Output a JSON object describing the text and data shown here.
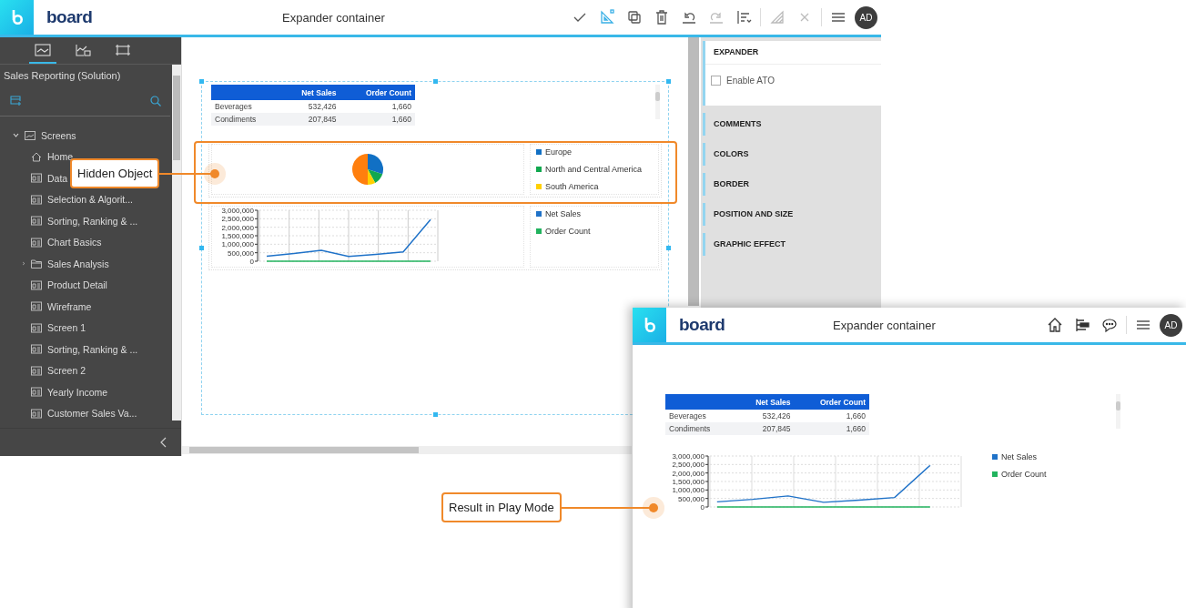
{
  "editor": {
    "brand": "board",
    "title": "Expander container",
    "toolbar": [
      {
        "kind": "check",
        "selected": false,
        "disabled": false
      },
      {
        "kind": "design",
        "selected": true,
        "disabled": false
      },
      {
        "kind": "duplicate",
        "selected": false,
        "disabled": false
      },
      {
        "kind": "delete",
        "selected": false,
        "disabled": false
      },
      {
        "kind": "undo",
        "selected": false,
        "disabled": false
      },
      {
        "kind": "redo",
        "selected": false,
        "disabled": true
      },
      {
        "kind": "align",
        "selected": false,
        "disabled": false
      },
      {
        "kind": "hatch",
        "selected": false,
        "disabled": true
      },
      {
        "kind": "close",
        "selected": false,
        "disabled": true
      },
      {
        "kind": "menu",
        "selected": false,
        "disabled": false
      }
    ],
    "avatar": "AD",
    "sidebar": {
      "tabs": [
        {
          "kind": "screens",
          "selected": true
        },
        {
          "kind": "charts",
          "selected": false
        },
        {
          "kind": "layout",
          "selected": false
        }
      ],
      "project": "Sales Reporting (Solution)",
      "tree": [
        {
          "label": "Screens",
          "kind": "root",
          "expanded": true,
          "children": [
            {
              "label": "Home",
              "kind": "home"
            },
            {
              "label": "Data",
              "kind": "screen"
            },
            {
              "label": "Selection & Algorit...",
              "kind": "screen"
            },
            {
              "label": "Sorting, Ranking & ...",
              "kind": "screen"
            },
            {
              "label": "Chart Basics",
              "kind": "screen"
            },
            {
              "label": "Sales Analysis",
              "kind": "folder",
              "expanded": false
            },
            {
              "label": "Product Detail",
              "kind": "screen"
            },
            {
              "label": "Wireframe",
              "kind": "screen"
            },
            {
              "label": "Screen 1",
              "kind": "screen"
            },
            {
              "label": "Sorting, Ranking & ...",
              "kind": "screen"
            },
            {
              "label": "Screen 2",
              "kind": "screen"
            },
            {
              "label": "Yearly Income",
              "kind": "screen"
            },
            {
              "label": "Customer Sales Va...",
              "kind": "screen"
            }
          ]
        }
      ]
    },
    "canvas": {
      "table": {
        "columns": [
          "",
          "Net Sales",
          "Order Count"
        ],
        "rows": [
          [
            "Beverages",
            "532,426",
            "1,660"
          ],
          [
            "Condiments",
            "207,845",
            "1,660"
          ]
        ]
      },
      "pie_legend": [
        {
          "label": "Europe",
          "color": "#1170c4"
        },
        {
          "label": "North and Central America",
          "color": "#11a84f"
        },
        {
          "label": "South America",
          "color": "#ffd000"
        }
      ],
      "line_chart": {
        "chart_data": {
          "type": "line",
          "grid": true,
          "ylim": [
            0,
            3000000
          ],
          "yticks": [
            {
              "value": 0,
              "label": "0"
            },
            {
              "value": 500000,
              "label": "500,000"
            },
            {
              "value": 1000000,
              "label": "1,000,000"
            },
            {
              "value": 1500000,
              "label": "1,500,000"
            },
            {
              "value": 2000000,
              "label": "2,000,000"
            },
            {
              "value": 2500000,
              "label": "2,500,000"
            },
            {
              "value": 3000000,
              "label": "3,000,000"
            }
          ],
          "series": [
            {
              "name": "Net Sales",
              "color": "#1f72c8",
              "values": [
                300000,
                450000,
                650000,
                280000,
                400000,
                550000,
                2450000
              ]
            },
            {
              "name": "Order Count",
              "color": "#22b35e",
              "values": [
                0,
                0,
                0,
                0,
                0,
                0,
                0
              ]
            }
          ]
        }
      }
    },
    "properties": [
      {
        "label": "EXPANDER",
        "expanded": true,
        "options": [
          {
            "label": "Enable ATO",
            "checked": false
          }
        ]
      },
      {
        "label": "COMMENTS",
        "expanded": false
      },
      {
        "label": "COLORS",
        "expanded": false
      },
      {
        "label": "BORDER",
        "expanded": false
      },
      {
        "label": "POSITION AND SIZE",
        "expanded": false
      },
      {
        "label": "GRAPHIC EFFECT",
        "expanded": false
      }
    ]
  },
  "play": {
    "brand": "board",
    "title": "Expander container",
    "avatar": "AD",
    "table": {
      "columns": [
        "",
        "Net Sales",
        "Order Count"
      ],
      "rows": [
        [
          "Beverages",
          "532,426",
          "1,660"
        ],
        [
          "Condiments",
          "207,845",
          "1,660"
        ]
      ]
    },
    "line_chart": {
      "chart_data": {
        "type": "line",
        "grid": true,
        "ylim": [
          0,
          3000000
        ],
        "yticks": [
          {
            "value": 0,
            "label": "0"
          },
          {
            "value": 500000,
            "label": "500,000"
          },
          {
            "value": 1000000,
            "label": "1,000,000"
          },
          {
            "value": 1500000,
            "label": "1,500,000"
          },
          {
            "value": 2000000,
            "label": "2,000,000"
          },
          {
            "value": 2500000,
            "label": "2,500,000"
          },
          {
            "value": 3000000,
            "label": "3,000,000"
          }
        ],
        "series": [
          {
            "name": "Net Sales",
            "color": "#1f72c8",
            "values": [
              300000,
              450000,
              650000,
              280000,
              400000,
              550000,
              2450000
            ]
          },
          {
            "name": "Order Count",
            "color": "#22b35e",
            "values": [
              0,
              0,
              0,
              0,
              0,
              0,
              0
            ]
          }
        ]
      }
    }
  },
  "callouts": [
    {
      "label": "Hidden Object"
    },
    {
      "label": "Result in Play Mode"
    }
  ]
}
